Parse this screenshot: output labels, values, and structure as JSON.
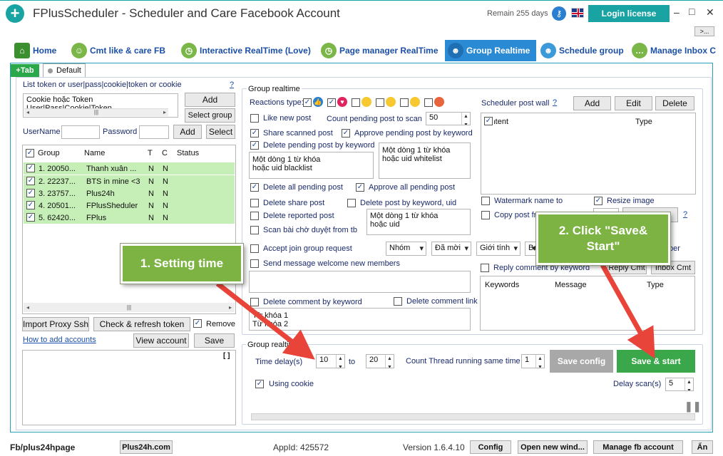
{
  "titlebar": {
    "title": "FPlusScheduler - Scheduler and Care Facebook Account",
    "remain": "Remain 255 days",
    "login": "Login license",
    "minimize": "–",
    "maximize": "□",
    "close": "✕",
    "more": ">..."
  },
  "tabs": [
    {
      "label": "Home",
      "color": "#3c8f2f"
    },
    {
      "label": "Cmt like & care FB",
      "color": "#7ab648"
    },
    {
      "label": "Interactive RealTime (Love)",
      "color": "#7ab648"
    },
    {
      "label": "Page manager RealTime",
      "color": "#7ab648"
    },
    {
      "label": "Group Realtime",
      "color": "#2a8ad4"
    },
    {
      "label": "Schedule group",
      "color": "#3c9ad8"
    },
    {
      "label": "Manage Inbox C",
      "color": "#7ab648"
    }
  ],
  "subtabs": {
    "add": "+Tab",
    "default": "Default"
  },
  "left": {
    "token_label": "List token or user|pass|cookie|token or cookie",
    "help": "?",
    "token_text": "Cookie hoặc Token\nUser|Pass|Cookie|Token",
    "add": "Add",
    "select_group": "Select group",
    "username": "UserName",
    "password": "Password",
    "add2": "Add",
    "select": "Select",
    "cols": [
      "Group",
      "Name",
      "T",
      "C",
      "Status"
    ],
    "rows": [
      {
        "group": "1. 20050...",
        "name": "Thanh xuân ...",
        "t": "N",
        "c": "N"
      },
      {
        "group": "2. 22237...",
        "name": "BTS in mine <3",
        "t": "N",
        "c": "N"
      },
      {
        "group": "3. 23757...",
        "name": "Plus24h",
        "t": "N",
        "c": "N"
      },
      {
        "group": "4. 20501...",
        "name": "FPlusSheduler",
        "t": "N",
        "c": "N"
      },
      {
        "group": "5. 62420...",
        "name": "FPlus",
        "t": "N",
        "c": "N"
      }
    ],
    "import_proxy": "Import Proxy Ssh",
    "check_token": "Check & refresh token",
    "remove": "Remove",
    "how_to": "How to add accounts",
    "view_account": "View account",
    "save": "Save",
    "log_btn": "[ ]"
  },
  "group_realtime": {
    "title": "Group realtime",
    "reactions_type": "Reactions type:",
    "like_new": "Like new post",
    "count_pending": "Count pending post to scan",
    "count_value": "50",
    "share_scanned": "Share scanned post",
    "approve_keyword": "Approve pending post by keyword",
    "delete_pending_keyword": "Delete pending post by keyword",
    "blacklist_text": "Một dòng 1 từ khóa\nhoặc uid blacklist",
    "whitelist_text": "Một dòng 1 từ khóa\nhoặc uid whitelist",
    "delete_all_pending": "Delete all pending post",
    "approve_all_pending": "Approve all pending post",
    "delete_share": "Delete share post",
    "delete_post_keyword": "Delete post by keyword, uid",
    "delete_reported": "Delete reported post",
    "keyword_uid_text": "Một dòng 1 từ khóa\nhoặc uid",
    "scan_pending": "Scan bài chờ duyệt from tb",
    "accept_join": "Accept join group request",
    "dd_group": "Nhóm",
    "dd_invited": "Đã mời",
    "dd_gender": "Giới tính",
    "dd_ba": "Ba",
    "send_welcome": "Send message welcome new members",
    "delete_comment_keyword": "Delete comment by keyword",
    "delete_comment_link": "Delete comment link",
    "comment_keywords_text": "Từ khóa 1\nTừ khóa 2"
  },
  "scheduler": {
    "title": "Scheduler post wall",
    "help": "?",
    "add": "Add",
    "edit": "Edit",
    "delete": "Delete",
    "col_content": "Content",
    "col_type": "Type",
    "watermark": "Watermark name to",
    "resize": "Resize image",
    "copy_post": "Copy post fro",
    "help2": "?",
    "member": "ber",
    "reply_comment": "Reply comment by keyword",
    "reply_cmt": "Reply Cmt",
    "inbox_cmt": "Inbox Cmt",
    "col_keywords": "Keywords",
    "col_message": "Message",
    "col_type2": "Type"
  },
  "bottom_group": {
    "title": "Group realtime",
    "time_delay": "Time delay(s)",
    "delay_from": "10",
    "to": "to",
    "delay_to": "20",
    "count_thread": "Count Thread running same time",
    "thread_value": "1",
    "save_config": "Save config",
    "save_start": "Save & start",
    "using_cookie": "Using cookie",
    "delay_scan": "Delay scan(s)",
    "delay_scan_value": "5"
  },
  "callouts": {
    "one": "1. Setting time",
    "two": "2. Click \"Save&\nStart\""
  },
  "statusbar": {
    "fb": "Fb/plus24hpage",
    "site": "Plus24h.com",
    "appid": "AppId: 425572",
    "version": "Version 1.6.4.10",
    "config": "Config",
    "open_new": "Open new wind...",
    "manage_fb": "Manage fb account",
    "hide": "Ẩn"
  }
}
